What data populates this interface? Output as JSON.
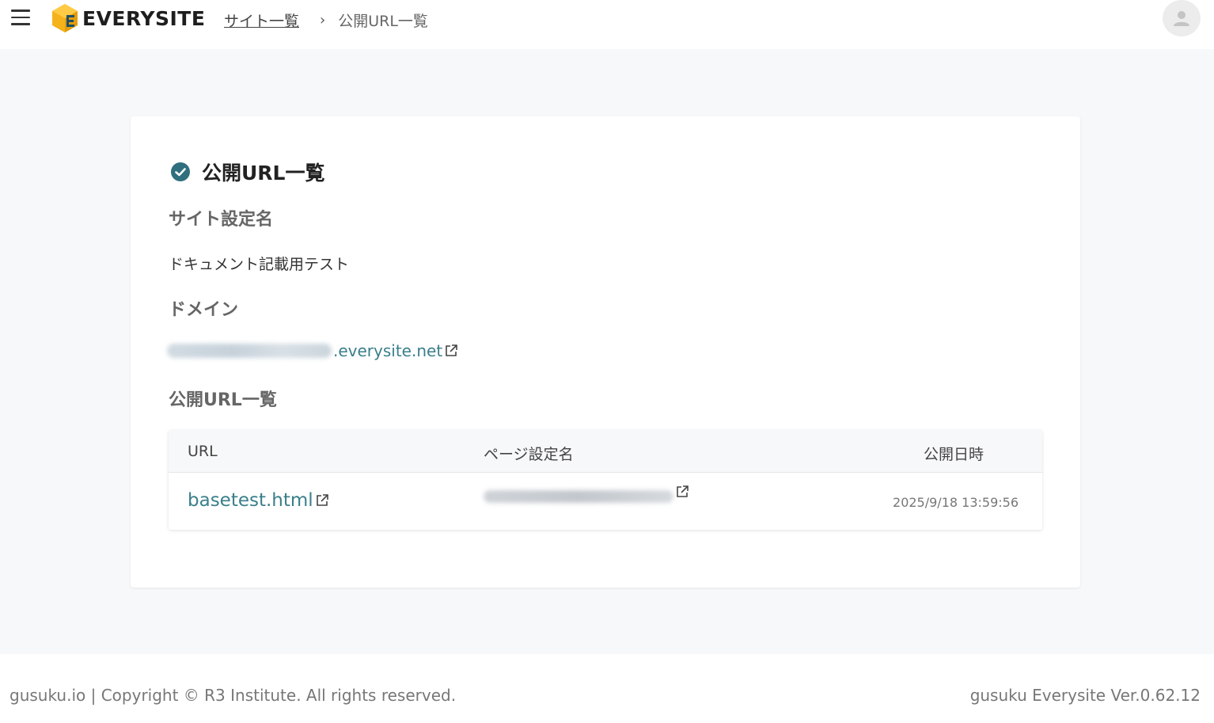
{
  "header": {
    "logo_text": "EVERYSITE",
    "breadcrumb": {
      "link": "サイト一覧",
      "separator": "›",
      "current": "公開URL一覧"
    }
  },
  "card": {
    "title": "公開URL一覧",
    "site_setting_label": "サイト設定名",
    "site_setting_value": "ドキュメント記載用テスト",
    "domain_label": "ドメイン",
    "domain_suffix": ".everysite.net",
    "url_list_label": "公開URL一覧",
    "table": {
      "headers": {
        "url": "URL",
        "page_setting": "ページ設定名",
        "published_at": "公開日時"
      },
      "rows": [
        {
          "url": "basetest.html",
          "published_at": "2025/9/18 13:59:56"
        }
      ]
    }
  },
  "footer": {
    "left": "gusuku.io | Copyright © R3 Institute. All rights reserved.",
    "right": "gusuku Everysite Ver.0.62.12"
  },
  "colors": {
    "accent": "#3a7f8a",
    "check": "#2f6f7e",
    "logo_yellow": "#f5b21b",
    "background": "#f7f8fa"
  }
}
